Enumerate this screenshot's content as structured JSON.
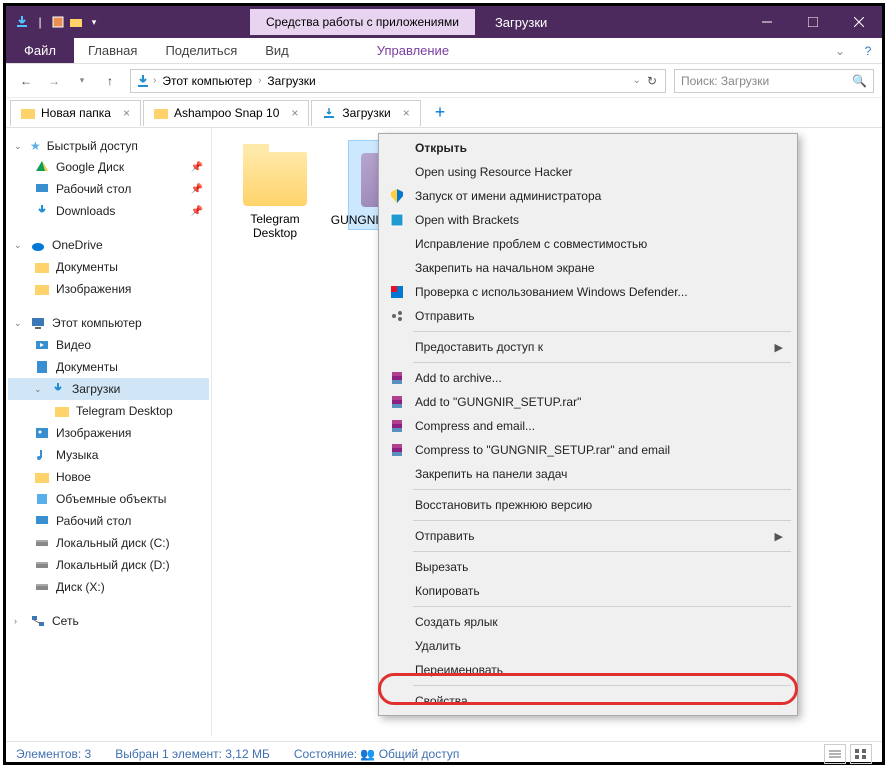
{
  "window": {
    "title": "Загрузки",
    "tabContext": "Средства работы с приложениями"
  },
  "ribbon": {
    "file": "Файл",
    "tabs": [
      "Главная",
      "Поделиться",
      "Вид"
    ],
    "contextTab": "Управление"
  },
  "nav": {
    "path": [
      "Этот компьютер",
      "Загрузки"
    ],
    "searchPlaceholder": "Поиск: Загрузки"
  },
  "folderTabs": [
    {
      "label": "Новая папка"
    },
    {
      "label": "Ashampoo Snap 10"
    },
    {
      "label": "Загрузки"
    }
  ],
  "sidebar": {
    "quick": {
      "label": "Быстрый доступ"
    },
    "quickItems": [
      {
        "label": "Google Диск",
        "pinned": true,
        "icon": "gdrive"
      },
      {
        "label": "Рабочий стол",
        "pinned": true,
        "icon": "desktop"
      },
      {
        "label": "Downloads",
        "pinned": true,
        "icon": "downloads"
      }
    ],
    "onedrive": {
      "label": "OneDrive"
    },
    "onedriveItems": [
      {
        "label": "Документы"
      },
      {
        "label": "Изображения"
      }
    ],
    "pc": {
      "label": "Этот компьютер"
    },
    "pcItems": [
      {
        "label": "Видео",
        "icon": "video"
      },
      {
        "label": "Документы",
        "icon": "doc"
      },
      {
        "label": "Загрузки",
        "icon": "downloads",
        "selected": true
      },
      {
        "label": "Telegram Desktop",
        "icon": "folder",
        "indent": 2
      },
      {
        "label": "Изображения",
        "icon": "pic"
      },
      {
        "label": "Музыка",
        "icon": "music"
      },
      {
        "label": "Новое",
        "icon": "folder"
      },
      {
        "label": "Объемные объекты",
        "icon": "3d"
      },
      {
        "label": "Рабочий стол",
        "icon": "desktop"
      },
      {
        "label": "Локальный диск (C:)",
        "icon": "drive"
      },
      {
        "label": "Локальный диск (D:)",
        "icon": "drive"
      },
      {
        "label": "Диск (X:)",
        "icon": "drive"
      }
    ],
    "network": {
      "label": "Сеть"
    }
  },
  "files": [
    {
      "name": "Telegram Desktop",
      "type": "folder"
    },
    {
      "name": "GUNGNIR_SETUP.exe",
      "type": "exe",
      "selected": true
    }
  ],
  "context": {
    "items": [
      {
        "label": "Открыть",
        "bold": true
      },
      {
        "label": "Open using Resource Hacker"
      },
      {
        "label": "Запуск от имени администратора",
        "icon": "shield"
      },
      {
        "label": "Open with Brackets",
        "icon": "brackets"
      },
      {
        "label": "Исправление проблем с совместимостью"
      },
      {
        "label": "Закрепить на начальном экране"
      },
      {
        "label": "Проверка с использованием Windows Defender...",
        "icon": "defender"
      },
      {
        "label": "Отправить",
        "icon": "share"
      },
      {
        "sep": true
      },
      {
        "label": "Предоставить доступ к",
        "arrow": true
      },
      {
        "sep": true
      },
      {
        "label": "Add to archive...",
        "icon": "rar"
      },
      {
        "label": "Add to \"GUNGNIR_SETUP.rar\"",
        "icon": "rar"
      },
      {
        "label": "Compress and email...",
        "icon": "rar"
      },
      {
        "label": "Compress to \"GUNGNIR_SETUP.rar\" and email",
        "icon": "rar"
      },
      {
        "label": "Закрепить на панели задач"
      },
      {
        "sep": true
      },
      {
        "label": "Восстановить прежнюю версию"
      },
      {
        "sep": true
      },
      {
        "label": "Отправить",
        "arrow": true
      },
      {
        "sep": true
      },
      {
        "label": "Вырезать"
      },
      {
        "label": "Копировать"
      },
      {
        "sep": true
      },
      {
        "label": "Создать ярлык"
      },
      {
        "label": "Удалить"
      },
      {
        "label": "Переименовать"
      },
      {
        "sep": true
      },
      {
        "label": "Свойства"
      }
    ]
  },
  "status": {
    "elements": "Элементов: 3",
    "selected": "Выбран 1 элемент: 3,12 МБ",
    "state": "Состояние:",
    "stateVal": "Общий доступ"
  }
}
